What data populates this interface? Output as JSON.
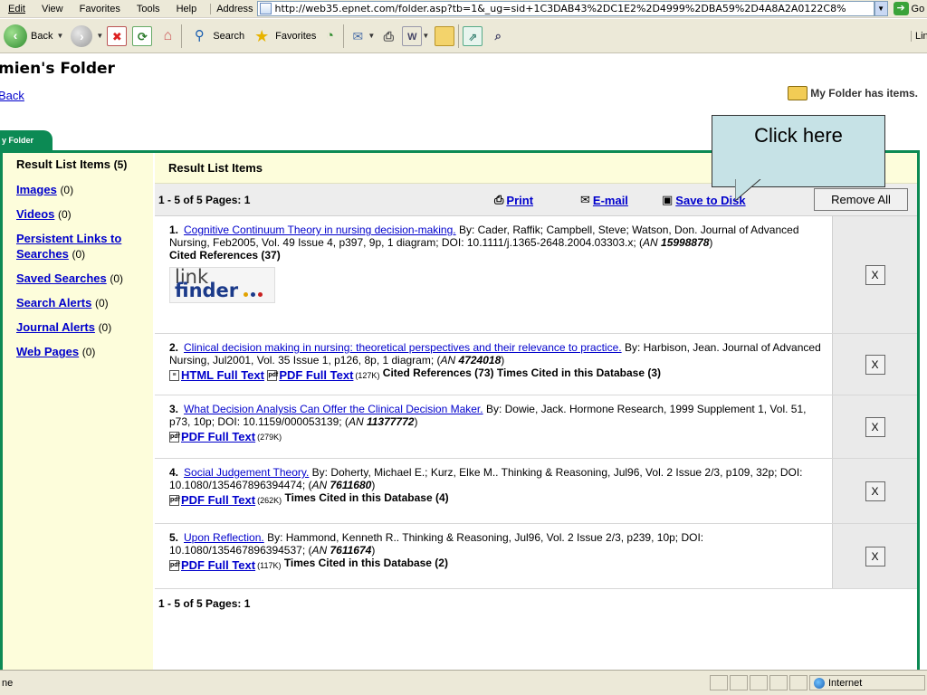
{
  "browser": {
    "menu": [
      "Edit",
      "View",
      "Favorites",
      "Tools",
      "Help"
    ],
    "address_label": "Address",
    "url": "http://web35.epnet.com/folder.asp?tb=1&_ug=sid+1C3DAB43%2DC1E2%2D4999%2DBA59%2D4A8A2A0122C8%",
    "go_label": "Go",
    "back_label": "Back",
    "search_label": "Search",
    "favorites_label": "Favorites",
    "links_label": "Links"
  },
  "page": {
    "title": "mien's Folder",
    "back_link": "Back",
    "folder_status": "My Folder has items.",
    "tab_label": "y Folder",
    "callout": "Click here"
  },
  "sidebar": {
    "items": [
      {
        "label": "Result List Items",
        "count": "(5)"
      },
      {
        "label": "Images",
        "count": "(0)"
      },
      {
        "label": "Videos",
        "count": "(0)"
      },
      {
        "label": "Persistent Links to Searches",
        "count": "(0)"
      },
      {
        "label": "Saved Searches",
        "count": "(0)"
      },
      {
        "label": "Search Alerts",
        "count": "(0)"
      },
      {
        "label": "Journal Alerts",
        "count": "(0)"
      },
      {
        "label": "Web Pages",
        "count": "(0)"
      }
    ]
  },
  "results": {
    "header": "Result List Items",
    "pagination": "1 - 5 of 5  Pages: 1",
    "print": "Print",
    "email": "E-mail",
    "save": "Save to Disk",
    "remove_all": "Remove All",
    "remove_label": "X",
    "items": [
      {
        "num": "1.",
        "title": "Cognitive Continuum Theory in nursing decision-making.",
        "by": " By: Cader, Raffik; Campbell, Steve; Watson, Don. Journal of Advanced Nursing, Feb2005, Vol. 49 Issue 4, p397, 9p, 1 diagram; DOI: 10.1111/j.1365-2648.2004.03303.x; (",
        "an_label": "AN",
        "an": "15998878",
        "cited": "Cited References (37)",
        "linkfinder_a": "link",
        "linkfinder_b": "finder"
      },
      {
        "num": "2.",
        "title": "Clinical decision making in nursing: theoretical perspectives and their relevance to practice.",
        "by": " By: Harbison, Jean. Journal of Advanced Nursing, Jul2001, Vol. 35 Issue 1, p126, 8p, 1 diagram; (",
        "an_label": "AN",
        "an": "4724018",
        "html_label": "HTML Full Text",
        "pdf_label": "PDF Full Text",
        "size": "(127K)",
        "cited": "Cited References (73)",
        "times": "Times Cited in this Database (3)"
      },
      {
        "num": "3.",
        "title": "What Decision Analysis Can Offer the Clinical Decision Maker.",
        "by": " By: Dowie, Jack. Hormone Research, 1999 Supplement 1, Vol. 51, p73, 10p; DOI: 10.1159/000053139; (",
        "an_label": "AN",
        "an": "11377772",
        "pdf_label": "PDF Full Text",
        "size": "(279K)"
      },
      {
        "num": "4.",
        "title": "Social Judgement Theory.",
        "by": " By: Doherty, Michael E.; Kurz, Elke M.. Thinking & Reasoning, Jul96, Vol. 2 Issue 2/3, p109, 32p; DOI: 10.1080/135467896394474; (",
        "an_label": "AN",
        "an": "7611680",
        "pdf_label": "PDF Full Text",
        "size": "(262K)",
        "times": "Times Cited in this Database (4)"
      },
      {
        "num": "5.",
        "title": "Upon Reflection.",
        "by": " By: Hammond, Kenneth R.. Thinking & Reasoning, Jul96, Vol. 2 Issue 2/3, p239, 10p; DOI: 10.1080/135467896394537; (",
        "an_label": "AN",
        "an": "7611674",
        "pdf_label": "PDF Full Text",
        "size": "(117K)",
        "times": "Times Cited in this Database (2)"
      }
    ],
    "pagination_bottom": "1 - 5 of 5  Pages: 1"
  },
  "statusbar": {
    "left": "ne",
    "zone": "Internet"
  }
}
